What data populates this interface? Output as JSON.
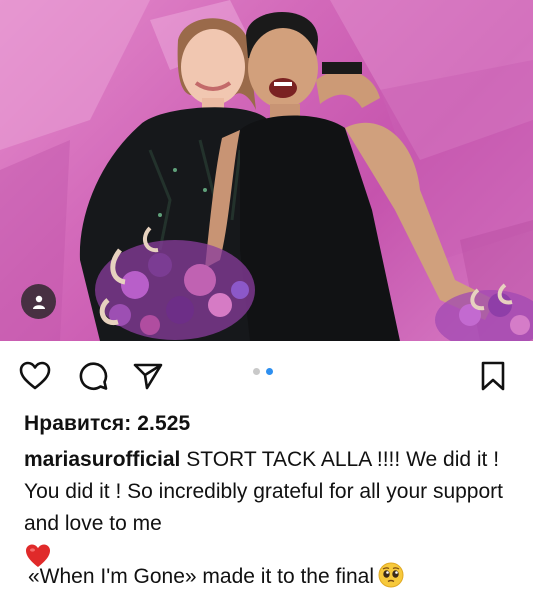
{
  "post": {
    "likes_label": "Нравится: 2.525",
    "username": "mariasurofficial",
    "caption_text": " STORT TACK ALLA !!!! We did it ! You did it ! So incredibly grateful for all your support and love to me",
    "final_line": "«When I'm Gone» made it to the final"
  },
  "carousel": {
    "count": 2,
    "active_index": 1
  },
  "icons": {
    "like": "heart-outline-icon",
    "comment": "speech-bubble-icon",
    "share": "paper-plane-icon",
    "save": "bookmark-outline-icon",
    "user_tag": "person-icon",
    "heart_emoji": "red-heart-emoji",
    "pleading_emoji": "pleading-face-emoji"
  },
  "colors": {
    "active_dot": "#2d8ff0",
    "inactive_dot": "#c9c9c9",
    "photo_background": "#d36aba"
  }
}
